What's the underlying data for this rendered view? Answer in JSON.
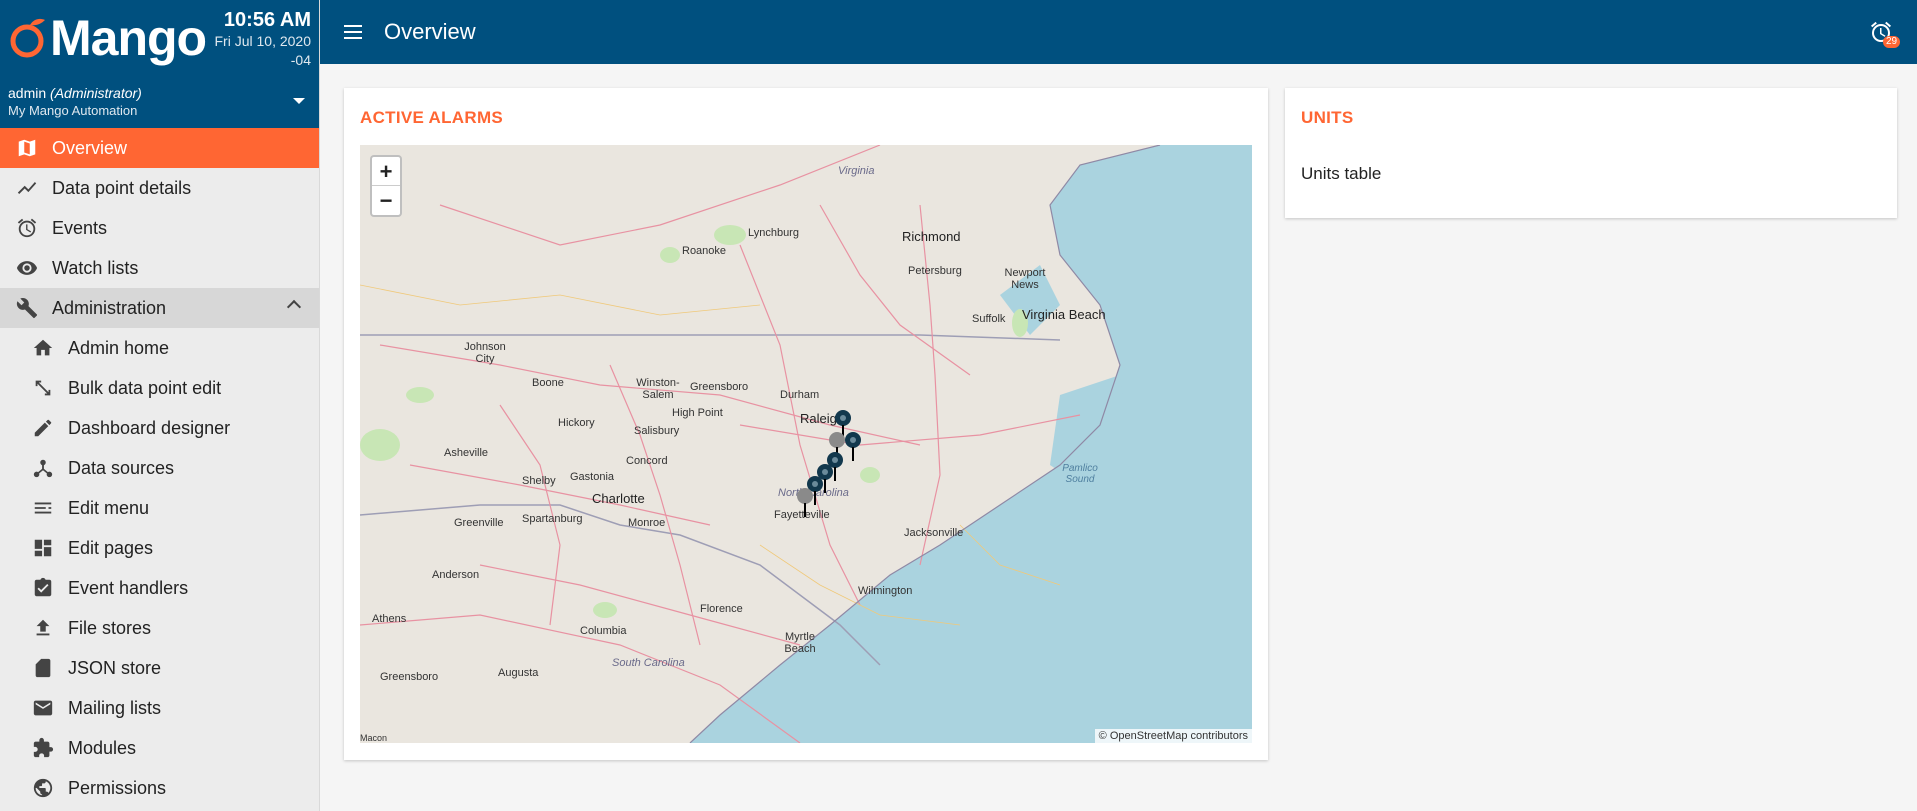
{
  "brand": {
    "name": "Mango",
    "accent": "#ff6633",
    "header_color": "#00507f"
  },
  "clock": {
    "time": "10:56 AM",
    "date": "Fri Jul 10, 2020 -04"
  },
  "user": {
    "name": "admin",
    "role": "(Administrator)",
    "site": "My Mango Automation"
  },
  "sidebar": {
    "items": [
      {
        "label": "Overview",
        "icon": "map-icon",
        "active": true
      },
      {
        "label": "Data point details",
        "icon": "trend-icon"
      },
      {
        "label": "Events",
        "icon": "alarm-icon"
      },
      {
        "label": "Watch lists",
        "icon": "eye-icon"
      },
      {
        "label": "Administration",
        "icon": "wrench-icon",
        "expanded": true
      }
    ],
    "admin_items": [
      {
        "label": "Admin home",
        "icon": "home-icon"
      },
      {
        "label": "Bulk data point edit",
        "icon": "resize-icon"
      },
      {
        "label": "Dashboard designer",
        "icon": "pencil-icon"
      },
      {
        "label": "Data sources",
        "icon": "hub-icon"
      },
      {
        "label": "Edit menu",
        "icon": "list-icon"
      },
      {
        "label": "Edit pages",
        "icon": "dashboard-icon"
      },
      {
        "label": "Event handlers",
        "icon": "clipboard-check-icon"
      },
      {
        "label": "File stores",
        "icon": "upload-icon"
      },
      {
        "label": "JSON store",
        "icon": "sd-card-icon"
      },
      {
        "label": "Mailing lists",
        "icon": "mail-icon"
      },
      {
        "label": "Modules",
        "icon": "puzzle-icon"
      },
      {
        "label": "Permissions",
        "icon": "globe-icon"
      }
    ]
  },
  "topbar": {
    "title": "Overview",
    "alarm_count": "29"
  },
  "alarms_card": {
    "title": "ACTIVE ALARMS",
    "attribution": "© OpenStreetMap contributors",
    "zoom_in": "+",
    "zoom_out": "−",
    "cities": [
      "Virginia",
      "Lynchburg",
      "Richmond",
      "Roanoke",
      "Petersburg",
      "Newport News",
      "Virginia Beach",
      "Suffolk",
      "Johnson City",
      "Boone",
      "Winston-Salem",
      "Greensboro",
      "Durham",
      "Raleigh",
      "High Point",
      "Hickory",
      "Salisbury",
      "Asheville",
      "Concord",
      "Shelby",
      "Gastonia",
      "Charlotte",
      "North Carolina",
      "Fayetteville",
      "Monroe",
      "Greenville",
      "Spartanburg",
      "Jacksonville",
      "Anderson",
      "Wilmington",
      "Florence",
      "Athens",
      "Columbia",
      "Myrtle Beach",
      "South Carolina",
      "Greensboro",
      "Augusta",
      "Pamlico Sound",
      "Macon"
    ]
  },
  "units_card": {
    "title": "UNITS",
    "text": "Units table"
  }
}
